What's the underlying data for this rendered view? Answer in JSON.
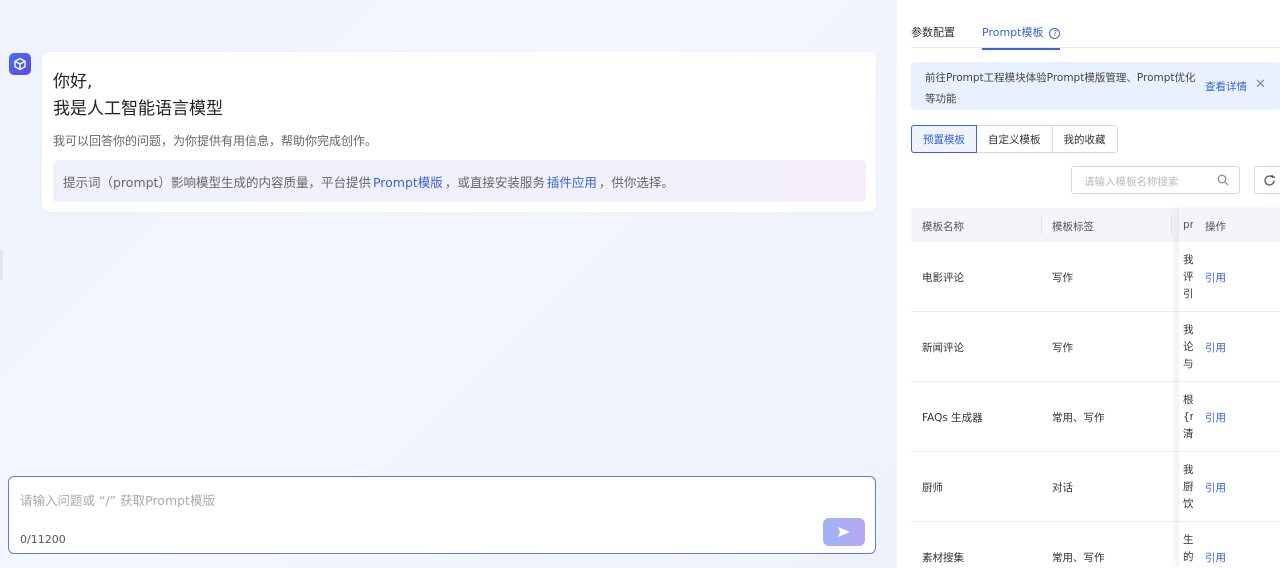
{
  "chat": {
    "greeting_line1": "你好,",
    "greeting_line2": "我是人工智能语言模型",
    "greeting_sub": "我可以回答你的问题，为你提供有用信息，帮助你完成创作。",
    "tip": {
      "prefix": "提示词（prompt）影响模型生成的内容质量，平台提供",
      "link1": "Prompt模版",
      "middle": "，或直接安装服务",
      "link2": "插件应用",
      "suffix": "，供你选择。"
    },
    "input": {
      "placeholder": "请输入问题或 “/” 获取Prompt模版",
      "counter": "0/11200"
    }
  },
  "panel": {
    "tabs": [
      {
        "label": "参数配置",
        "active": false
      },
      {
        "label": "Prompt模板",
        "active": true
      }
    ],
    "notice": {
      "text": "前往Prompt工程模块体验Prompt模版管理、Prompt优化等功能",
      "link": "查看详情"
    },
    "segments": [
      {
        "label": "预置模板",
        "active": true
      },
      {
        "label": "自定义模板",
        "active": false
      },
      {
        "label": "我的收藏",
        "active": false
      }
    ],
    "search_placeholder": "请输入模板名称搜索",
    "table": {
      "headers": [
        "模板名称",
        "模板标签",
        "pr",
        "操作"
      ],
      "rows": [
        {
          "name": "电影评论",
          "tags": "写作",
          "prompt": [
            "我",
            "评",
            "引"
          ],
          "action": "引用"
        },
        {
          "name": "新闻评论",
          "tags": "写作",
          "prompt": [
            "我",
            "论",
            "与"
          ],
          "action": "引用"
        },
        {
          "name": "FAQs 生成器",
          "tags": "常用、写作",
          "prompt": [
            "根",
            "{n",
            "清"
          ],
          "action": "引用"
        },
        {
          "name": "厨师",
          "tags": "对话",
          "prompt": [
            "我",
            "厨",
            "饮"
          ],
          "action": "引用"
        },
        {
          "name": "素材搜集",
          "tags": "常用、写作",
          "prompt": [
            "生",
            "的"
          ],
          "action": "引用"
        }
      ]
    }
  },
  "colors": {
    "accent": "#3a63d9",
    "notice_bg": "#e8f1fe",
    "chat_bg": "#eef3fc"
  }
}
